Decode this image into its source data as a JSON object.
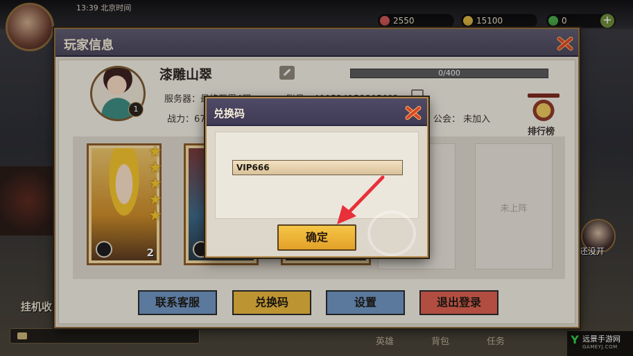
{
  "top": {
    "time_text": "13:39 北京时间",
    "resources": [
      "2550",
      "15100",
      "0"
    ]
  },
  "left": {
    "idle_label": "挂机收"
  },
  "right": {
    "char_label": "还没开"
  },
  "bottom_nav": [
    "英雄",
    "背包",
    "任务"
  ],
  "watermark": {
    "name": "远景手游网",
    "sub": "GAMEYJ.COM"
  },
  "panel": {
    "title": "玩家信息",
    "player_name": "漆雕山翠",
    "avatar_level": "1",
    "exp_text": "0/400",
    "server_text": "服务器：最终至累4服",
    "account_text": "账号：4005241588050?3",
    "power_text": "战力：67",
    "guild_text": "公会：  未加入",
    "rank_label": "排行榜",
    "heroes": [
      {
        "level": "2"
      },
      {
        "level": ""
      }
    ],
    "empty_slot_label": "未上阵",
    "buttons": {
      "service": "联系客服",
      "code": "兑换码",
      "settings": "设置",
      "logout": "退出登录"
    }
  },
  "dialog": {
    "title": "兑换码",
    "input_value": "VIP666",
    "confirm_label": "确定"
  },
  "colors": {
    "panel_header": "#4a465a",
    "code_button": "#e7b53e",
    "service_button": "#6f93c0",
    "logout_button": "#d86050",
    "arrow": "#e8303a"
  }
}
